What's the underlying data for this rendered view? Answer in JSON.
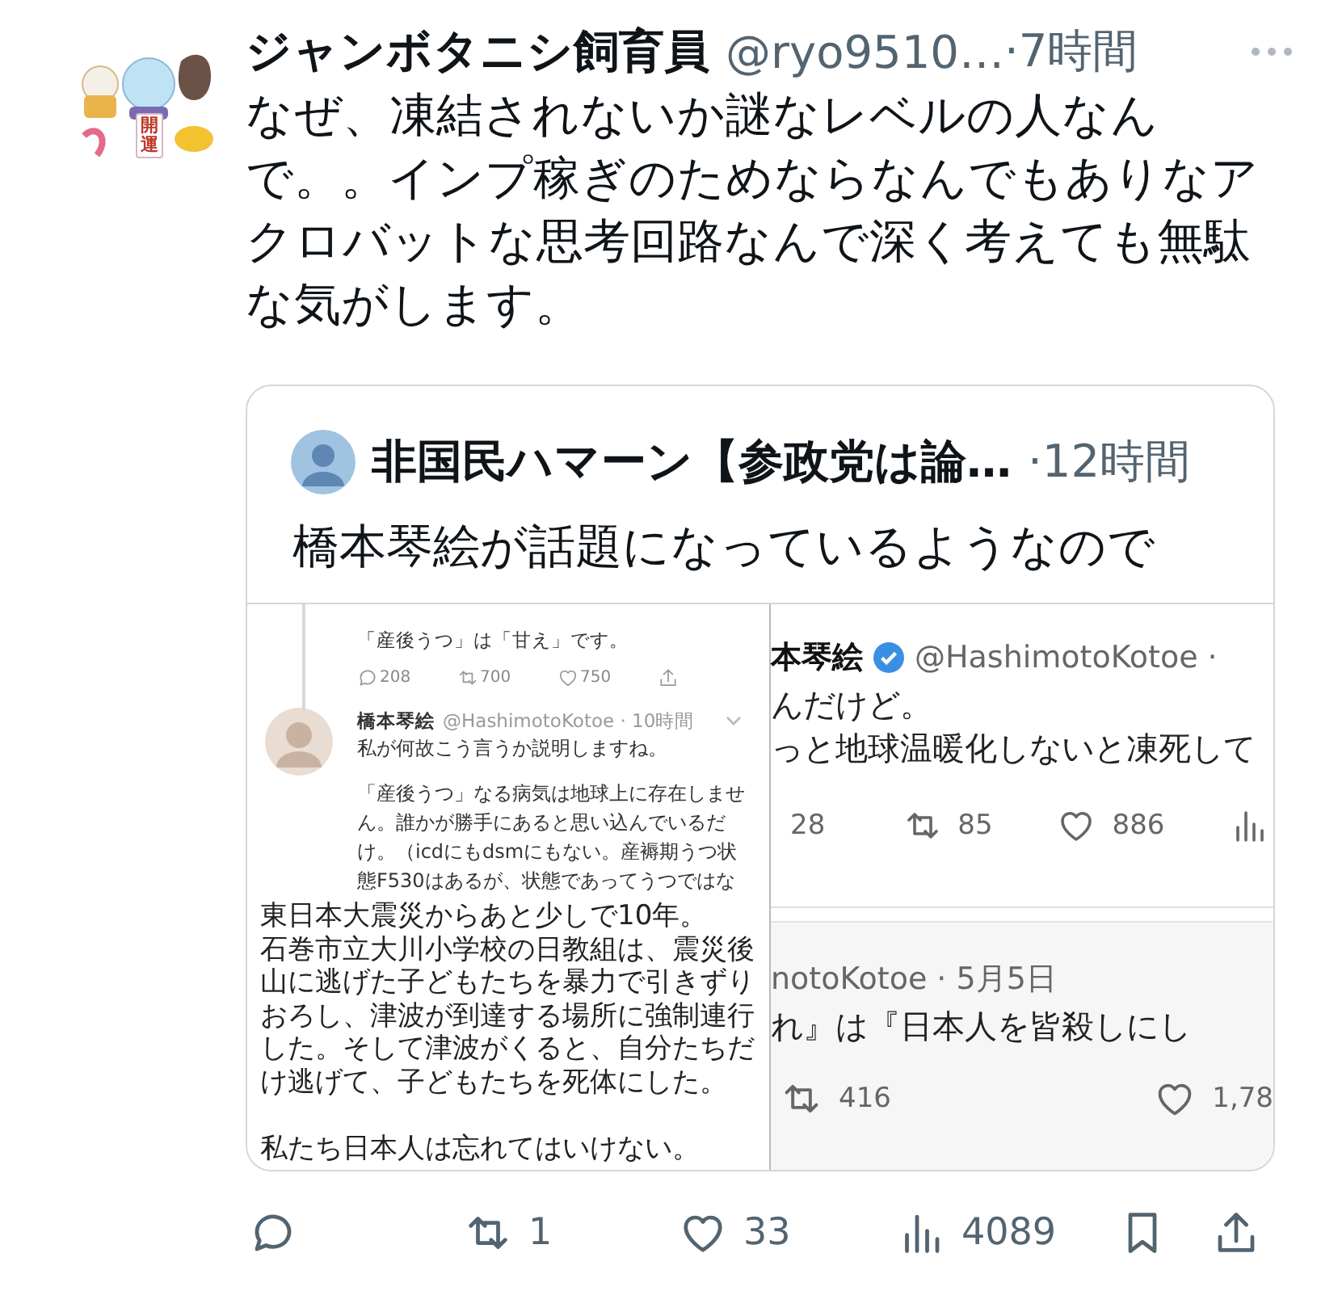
{
  "post": {
    "author_name": "ジャンボタニシ飼育員",
    "handle": "@ryo9510…",
    "time": "·7時間",
    "avatar_label": "開運",
    "text": "なぜ、凍結されないか謎なレベルの人なんで。。インプ稼ぎのためならなんでもありなアクロバットな思考回路なんで深く考えても無駄な気がします。"
  },
  "quote": {
    "author_name": "非国民ハマーン【参政党は論…",
    "time": "·12時間",
    "text": "橋本琴絵が話題になっているようなので",
    "image": {
      "left": {
        "parent_text": "「産後うつ」は「甘え」です。",
        "parent_actions": [
          {
            "kind": "reply",
            "count": "208"
          },
          {
            "kind": "repost",
            "count": "700"
          },
          {
            "kind": "like",
            "count": "750"
          },
          {
            "kind": "share"
          }
        ],
        "author_name": "橋本琴絵",
        "handle": "@HashimotoKotoe · 10時間",
        "text": "私が何故こう言うか説明しますね。",
        "body": "「産後うつ」なる病気は地球上に存在しません。誰かが勝手にあると思い込んでいるだけ。（icdにもdsmにもない。産褥期うつ状態F530はあるが、状態であってうつではな",
        "caption": [
          "東日本大震災からあと少しで10年。",
          "石巻市立大川小学校の日教組は、震災後山に逃げた子どもたちを暴力で引きずりおろし、津波が到達する場所に強制連行した。そして津波がくると、自分たちだけ逃げて、子どもたちを死体にした。",
          "私たち日本人は忘れてはいけない。"
        ]
      },
      "right_top": {
        "author_name": "本琴絵",
        "handle": "@HashimotoKotoe ·",
        "text": [
          "んだけど。",
          "っと地球温暖化しないと凍死して"
        ],
        "actions": [
          {
            "kind": "bare",
            "count": "28"
          },
          {
            "kind": "repost",
            "count": "85"
          },
          {
            "kind": "like",
            "count": "886"
          },
          {
            "kind": "views"
          }
        ]
      },
      "right_bottom": {
        "handle": "notoKotoe · 5月5日",
        "text": "れ』は『日本人を皆殺しにし",
        "actions": [
          {
            "kind": "repost",
            "count": "416"
          },
          {
            "kind": "like",
            "count": "1,78"
          }
        ]
      }
    }
  },
  "actions": [
    {
      "kind": "reply"
    },
    {
      "kind": "repost",
      "count": "1"
    },
    {
      "kind": "like",
      "count": "33"
    },
    {
      "kind": "views",
      "count": "4089"
    },
    {
      "kind": "bookmark"
    },
    {
      "kind": "share"
    }
  ]
}
